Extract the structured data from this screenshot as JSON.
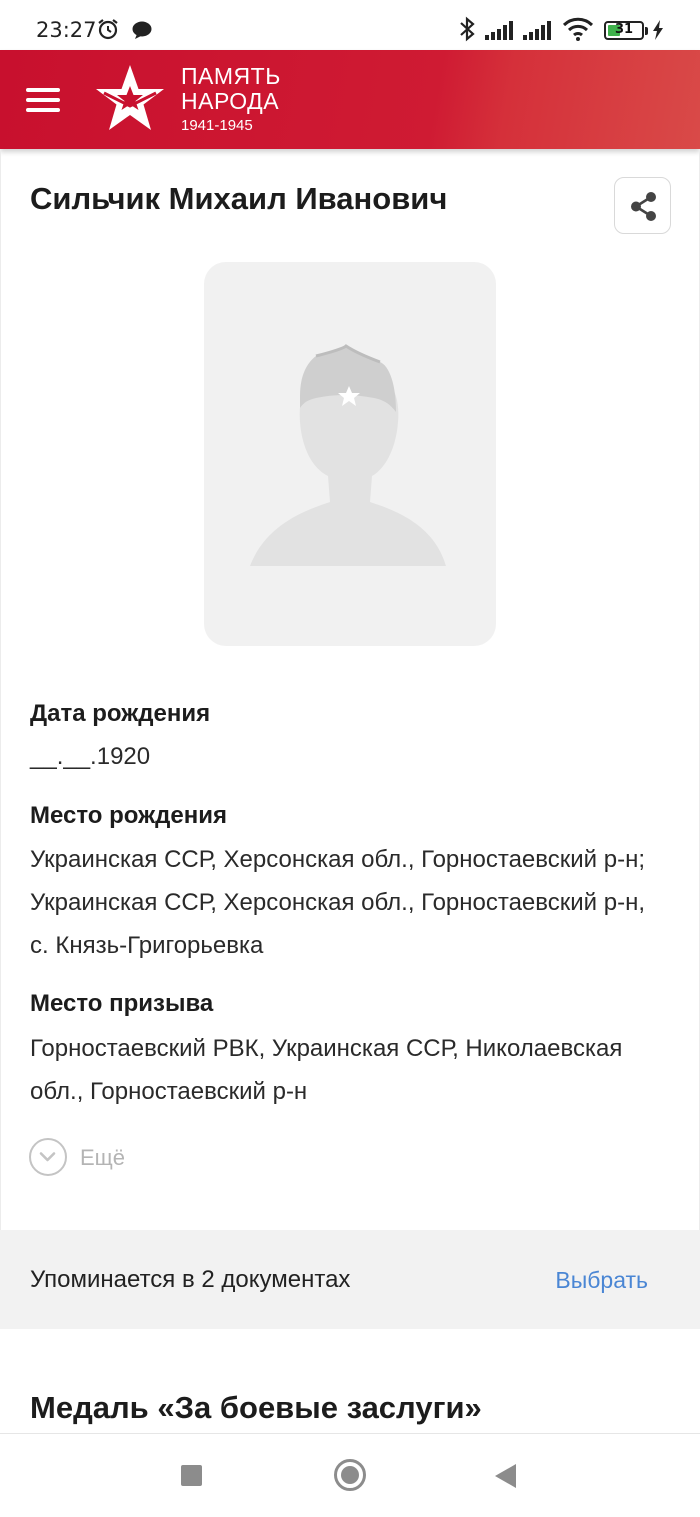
{
  "status_bar": {
    "time": "23:27",
    "battery_level": "31",
    "icons": [
      "alarm-icon",
      "chat-bubble-icon",
      "bluetooth-icon",
      "signal-icon",
      "signal-icon",
      "wifi-icon",
      "battery-icon",
      "charging-icon"
    ]
  },
  "header": {
    "logo_line1": "ПАМЯТЬ",
    "logo_line2": "НАРОДА",
    "logo_years": "1941-1945",
    "brand_color": "#c8102e",
    "icons": [
      "menu-icon",
      "star-logo-icon"
    ]
  },
  "person": {
    "name": "Сильчик Михаил Иванович",
    "photo_placeholder_icon": "soldier-silhouette-icon",
    "fields": [
      {
        "label": "Дата рождения",
        "value": "__.__.1920"
      },
      {
        "label": "Место рождения",
        "value": "Украинская ССР, Херсонская обл., Горностаевский р-н; Украинская ССР, Херсонская обл., Горностаевский р-н, с. Князь-Григорьевка"
      },
      {
        "label": "Место призыва",
        "value": "Горностаевский РВК, Украинская ССР, Николаевская обл., Горностаевский р-н"
      }
    ],
    "more_label": "Ещё"
  },
  "documents": {
    "text": "Упоминается в 2 документах",
    "link": "Выбрать",
    "link_color": "#4a86d4"
  },
  "award": {
    "title": "Медаль «За боевые заслуги»"
  },
  "nav_bar": {
    "icons": [
      "recents-square-icon",
      "home-circle-icon",
      "back-triangle-icon"
    ]
  }
}
